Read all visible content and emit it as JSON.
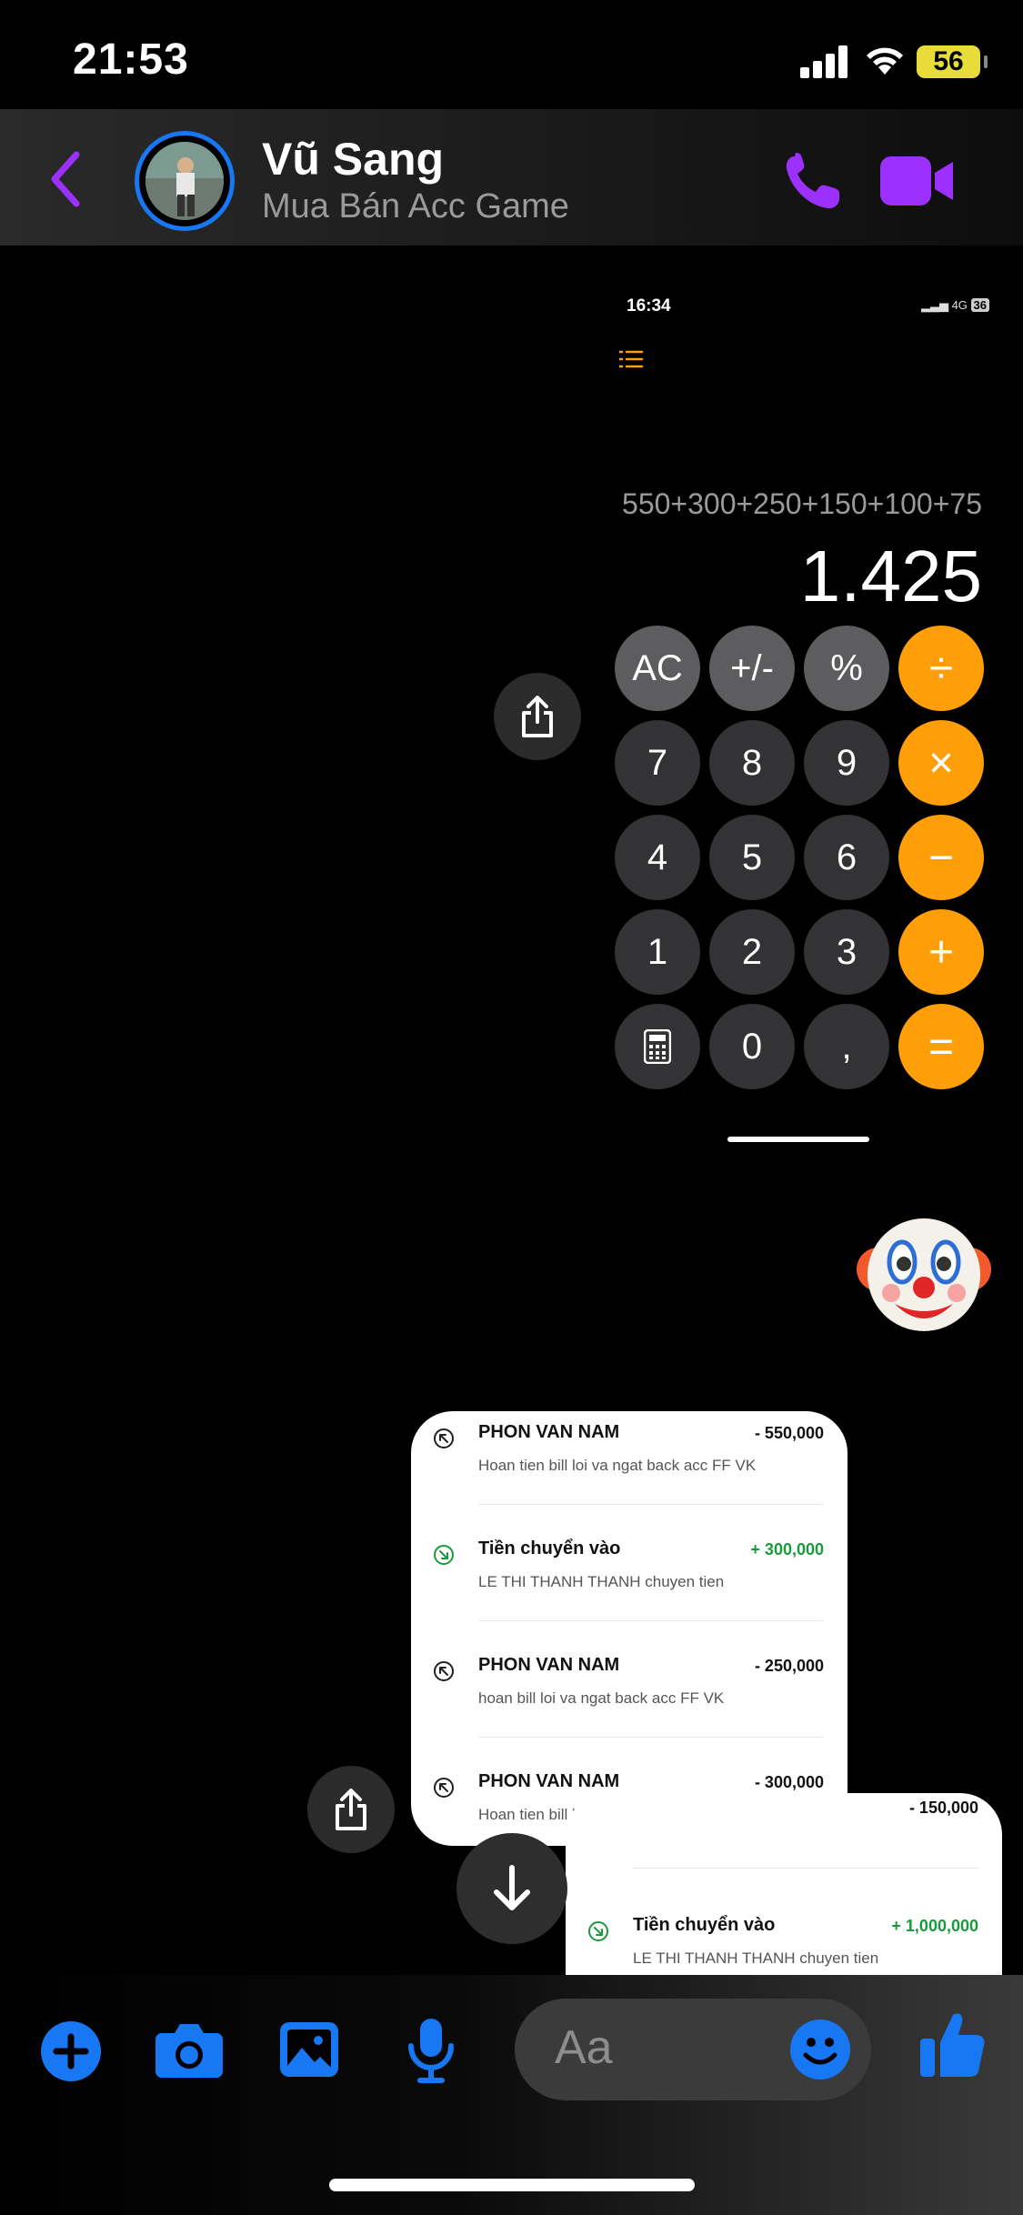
{
  "status_bar": {
    "time": "21:53",
    "battery": "56"
  },
  "header": {
    "contact_name": "Vũ Sang",
    "contact_subtitle": "Mua Bán Acc Game",
    "colors": {
      "accent": "#9b30ff",
      "ring": "#1877f2"
    }
  },
  "calculator_image": {
    "time": "16:34",
    "network": "4G",
    "battery": "36",
    "expression": "550+300+250+150+100+75",
    "result": "1.425",
    "keys": [
      "AC",
      "+/-",
      "%",
      "÷",
      "7",
      "8",
      "9",
      "×",
      "4",
      "5",
      "6",
      "−",
      "1",
      "2",
      "3",
      "+",
      "calculator-icon",
      "0",
      ",",
      "="
    ]
  },
  "reaction_emoji": "clown-face",
  "bank_image": {
    "transactions": [
      {
        "name": "PHON VAN NAM",
        "amount": "- 550,000",
        "desc": "Hoan tien bill loi va ngat back acc FF VK",
        "direction": "out"
      },
      {
        "name": "Tiền chuyển vào",
        "amount": "+ 300,000",
        "desc": "LE THI THANH THANH chuyen tien",
        "direction": "in"
      },
      {
        "name": "PHON VAN NAM",
        "amount": "- 250,000",
        "desc": "hoan bill loi va ngat back acc FF VK",
        "direction": "out"
      },
      {
        "name": "PHON VAN NAM",
        "amount": "- 300,000",
        "desc": "Hoan tien bill loi va ngat back acc FF VK",
        "direction": "out"
      }
    ]
  },
  "bank_image_2": {
    "top_amount": "- 150,000",
    "transactions": [
      {
        "name": "Tiền chuyển vào",
        "amount": "+ 1,000,000",
        "desc": "LE THI THANH THANH chuyen tien",
        "direction": "in"
      }
    ]
  },
  "composer": {
    "placeholder": "Aa",
    "accent": "#1877f2"
  }
}
